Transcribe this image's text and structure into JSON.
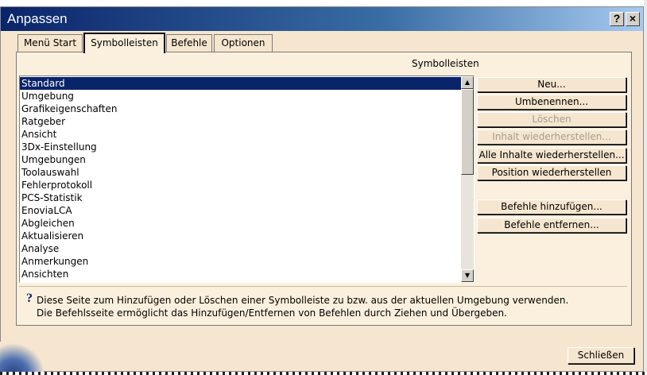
{
  "window": {
    "title": "Anpassen",
    "help_label": "?",
    "close_label": "×"
  },
  "tabs": [
    {
      "label": "Menü Start"
    },
    {
      "label": "Symbolleisten"
    },
    {
      "label": "Befehle"
    },
    {
      "label": "Optionen"
    }
  ],
  "list": {
    "label": "Symbolleisten",
    "selected": "Standard",
    "items": [
      "Standard",
      "Umgebung",
      "Grafikeigenschaften",
      "Ratgeber",
      "Ansicht",
      "3Dx-Einstellung",
      "Umgebungen",
      "Toolauswahl",
      "Fehlerprotokoll",
      "PCS-Statistik",
      "EnoviaLCA",
      "Abgleichen",
      "Aktualisieren",
      "Analyse",
      "Anmerkungen",
      "Ansichten"
    ]
  },
  "buttons": {
    "neu": "Neu...",
    "umbenennen": "Umbenennen...",
    "loeschen": "Löschen",
    "inhalt": "Inhalt wiederherstellen...",
    "alle_inhalte": "Alle Inhalte wiederherstellen...",
    "position": "Position wiederherstellen",
    "befehle_hinzufuegen": "Befehle hinzufügen...",
    "befehle_entfernen": "Befehle entfernen..."
  },
  "info": {
    "line1": "Diese Seite zum Hinzufügen oder Löschen einer Symbolleiste zu bzw. aus der aktuellen Umgebung verwenden.",
    "line2": "Die Befehlsseite ermöglicht das Hinzufügen/Entfernen von Befehlen durch Ziehen und Übergeben."
  },
  "footer": {
    "close_label": "Schließen"
  }
}
